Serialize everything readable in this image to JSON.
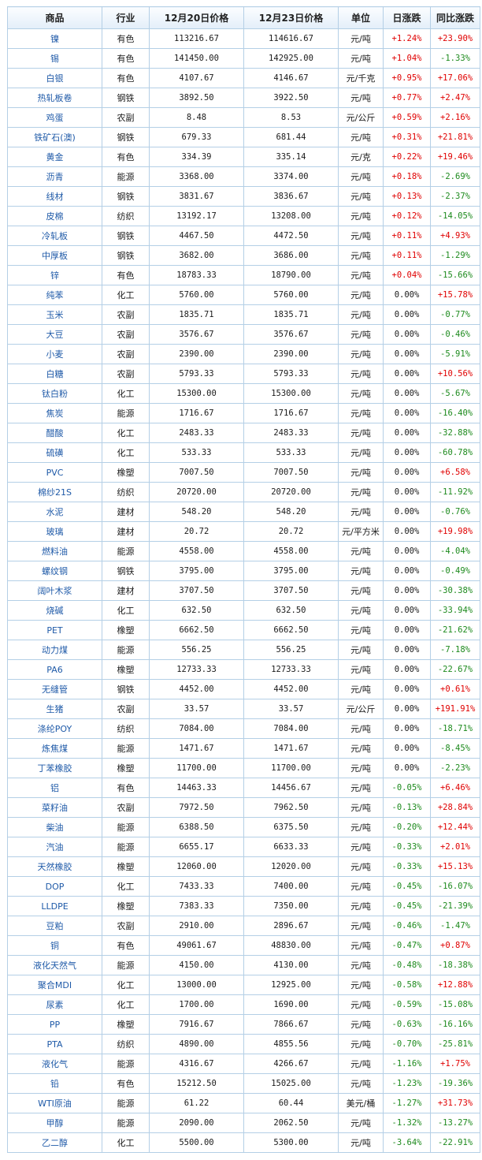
{
  "headers": [
    "商品",
    "行业",
    "12月20日价格",
    "12月23日价格",
    "单位",
    "日涨跌",
    "同比涨跌"
  ],
  "rows": [
    [
      "镍",
      "有色",
      "113216.67",
      "114616.67",
      "元/吨",
      "+1.24%",
      "+23.90%"
    ],
    [
      "锡",
      "有色",
      "141450.00",
      "142925.00",
      "元/吨",
      "+1.04%",
      "-1.33%"
    ],
    [
      "白银",
      "有色",
      "4107.67",
      "4146.67",
      "元/千克",
      "+0.95%",
      "+17.06%"
    ],
    [
      "热轧板卷",
      "钢铁",
      "3892.50",
      "3922.50",
      "元/吨",
      "+0.77%",
      "+2.47%"
    ],
    [
      "鸡蛋",
      "农副",
      "8.48",
      "8.53",
      "元/公斤",
      "+0.59%",
      "+2.16%"
    ],
    [
      "铁矿石(澳)",
      "钢铁",
      "679.33",
      "681.44",
      "元/吨",
      "+0.31%",
      "+21.81%"
    ],
    [
      "黄金",
      "有色",
      "334.39",
      "335.14",
      "元/克",
      "+0.22%",
      "+19.46%"
    ],
    [
      "沥青",
      "能源",
      "3368.00",
      "3374.00",
      "元/吨",
      "+0.18%",
      "-2.69%"
    ],
    [
      "线材",
      "钢铁",
      "3831.67",
      "3836.67",
      "元/吨",
      "+0.13%",
      "-2.37%"
    ],
    [
      "皮棉",
      "纺织",
      "13192.17",
      "13208.00",
      "元/吨",
      "+0.12%",
      "-14.05%"
    ],
    [
      "冷轧板",
      "钢铁",
      "4467.50",
      "4472.50",
      "元/吨",
      "+0.11%",
      "+4.93%"
    ],
    [
      "中厚板",
      "钢铁",
      "3682.00",
      "3686.00",
      "元/吨",
      "+0.11%",
      "-1.29%"
    ],
    [
      "锌",
      "有色",
      "18783.33",
      "18790.00",
      "元/吨",
      "+0.04%",
      "-15.66%"
    ],
    [
      "纯苯",
      "化工",
      "5760.00",
      "5760.00",
      "元/吨",
      "0.00%",
      "+15.78%"
    ],
    [
      "玉米",
      "农副",
      "1835.71",
      "1835.71",
      "元/吨",
      "0.00%",
      "-0.77%"
    ],
    [
      "大豆",
      "农副",
      "3576.67",
      "3576.67",
      "元/吨",
      "0.00%",
      "-0.46%"
    ],
    [
      "小麦",
      "农副",
      "2390.00",
      "2390.00",
      "元/吨",
      "0.00%",
      "-5.91%"
    ],
    [
      "白糖",
      "农副",
      "5793.33",
      "5793.33",
      "元/吨",
      "0.00%",
      "+10.56%"
    ],
    [
      "钛白粉",
      "化工",
      "15300.00",
      "15300.00",
      "元/吨",
      "0.00%",
      "-5.67%"
    ],
    [
      "焦炭",
      "能源",
      "1716.67",
      "1716.67",
      "元/吨",
      "0.00%",
      "-16.40%"
    ],
    [
      "醋酸",
      "化工",
      "2483.33",
      "2483.33",
      "元/吨",
      "0.00%",
      "-32.88%"
    ],
    [
      "硫磺",
      "化工",
      "533.33",
      "533.33",
      "元/吨",
      "0.00%",
      "-60.78%"
    ],
    [
      "PVC",
      "橡塑",
      "7007.50",
      "7007.50",
      "元/吨",
      "0.00%",
      "+6.58%"
    ],
    [
      "棉纱21S",
      "纺织",
      "20720.00",
      "20720.00",
      "元/吨",
      "0.00%",
      "-11.92%"
    ],
    [
      "水泥",
      "建材",
      "548.20",
      "548.20",
      "元/吨",
      "0.00%",
      "-0.76%"
    ],
    [
      "玻璃",
      "建材",
      "20.72",
      "20.72",
      "元/平方米",
      "0.00%",
      "+19.98%"
    ],
    [
      "燃料油",
      "能源",
      "4558.00",
      "4558.00",
      "元/吨",
      "0.00%",
      "-4.04%"
    ],
    [
      "螺纹钢",
      "钢铁",
      "3795.00",
      "3795.00",
      "元/吨",
      "0.00%",
      "-0.49%"
    ],
    [
      "阔叶木浆",
      "建材",
      "3707.50",
      "3707.50",
      "元/吨",
      "0.00%",
      "-30.38%"
    ],
    [
      "烧碱",
      "化工",
      "632.50",
      "632.50",
      "元/吨",
      "0.00%",
      "-33.94%"
    ],
    [
      "PET",
      "橡塑",
      "6662.50",
      "6662.50",
      "元/吨",
      "0.00%",
      "-21.62%"
    ],
    [
      "动力煤",
      "能源",
      "556.25",
      "556.25",
      "元/吨",
      "0.00%",
      "-7.18%"
    ],
    [
      "PA6",
      "橡塑",
      "12733.33",
      "12733.33",
      "元/吨",
      "0.00%",
      "-22.67%"
    ],
    [
      "无缝管",
      "钢铁",
      "4452.00",
      "4452.00",
      "元/吨",
      "0.00%",
      "+0.61%"
    ],
    [
      "生猪",
      "农副",
      "33.57",
      "33.57",
      "元/公斤",
      "0.00%",
      "+191.91%"
    ],
    [
      "涤纶POY",
      "纺织",
      "7084.00",
      "7084.00",
      "元/吨",
      "0.00%",
      "-18.71%"
    ],
    [
      "炼焦煤",
      "能源",
      "1471.67",
      "1471.67",
      "元/吨",
      "0.00%",
      "-8.45%"
    ],
    [
      "丁苯橡胶",
      "橡塑",
      "11700.00",
      "11700.00",
      "元/吨",
      "0.00%",
      "-2.23%"
    ],
    [
      "铝",
      "有色",
      "14463.33",
      "14456.67",
      "元/吨",
      "-0.05%",
      "+6.46%"
    ],
    [
      "菜籽油",
      "农副",
      "7972.50",
      "7962.50",
      "元/吨",
      "-0.13%",
      "+28.84%"
    ],
    [
      "柴油",
      "能源",
      "6388.50",
      "6375.50",
      "元/吨",
      "-0.20%",
      "+12.44%"
    ],
    [
      "汽油",
      "能源",
      "6655.17",
      "6633.33",
      "元/吨",
      "-0.33%",
      "+2.01%"
    ],
    [
      "天然橡胶",
      "橡塑",
      "12060.00",
      "12020.00",
      "元/吨",
      "-0.33%",
      "+15.13%"
    ],
    [
      "DOP",
      "化工",
      "7433.33",
      "7400.00",
      "元/吨",
      "-0.45%",
      "-16.07%"
    ],
    [
      "LLDPE",
      "橡塑",
      "7383.33",
      "7350.00",
      "元/吨",
      "-0.45%",
      "-21.39%"
    ],
    [
      "豆粕",
      "农副",
      "2910.00",
      "2896.67",
      "元/吨",
      "-0.46%",
      "-1.47%"
    ],
    [
      "铜",
      "有色",
      "49061.67",
      "48830.00",
      "元/吨",
      "-0.47%",
      "+0.87%"
    ],
    [
      "液化天然气",
      "能源",
      "4150.00",
      "4130.00",
      "元/吨",
      "-0.48%",
      "-18.38%"
    ],
    [
      "聚合MDI",
      "化工",
      "13000.00",
      "12925.00",
      "元/吨",
      "-0.58%",
      "+12.88%"
    ],
    [
      "尿素",
      "化工",
      "1700.00",
      "1690.00",
      "元/吨",
      "-0.59%",
      "-15.08%"
    ],
    [
      "PP",
      "橡塑",
      "7916.67",
      "7866.67",
      "元/吨",
      "-0.63%",
      "-16.16%"
    ],
    [
      "PTA",
      "纺织",
      "4890.00",
      "4855.56",
      "元/吨",
      "-0.70%",
      "-25.81%"
    ],
    [
      "液化气",
      "能源",
      "4316.67",
      "4266.67",
      "元/吨",
      "-1.16%",
      "+1.75%"
    ],
    [
      "铅",
      "有色",
      "15212.50",
      "15025.00",
      "元/吨",
      "-1.23%",
      "-19.36%"
    ],
    [
      "WTI原油",
      "能源",
      "61.22",
      "60.44",
      "美元/桶",
      "-1.27%",
      "+31.73%"
    ],
    [
      "甲醇",
      "能源",
      "2090.00",
      "2062.50",
      "元/吨",
      "-1.32%",
      "-13.27%"
    ],
    [
      "乙二醇",
      "化工",
      "5500.00",
      "5300.00",
      "元/吨",
      "-3.64%",
      "-22.91%"
    ]
  ],
  "colors": {
    "up": "#e00000",
    "down": "#1d8a1d",
    "name_link": "#1f5aa8",
    "border": "#b4cfe6",
    "header_bg": "#e3eef9"
  }
}
